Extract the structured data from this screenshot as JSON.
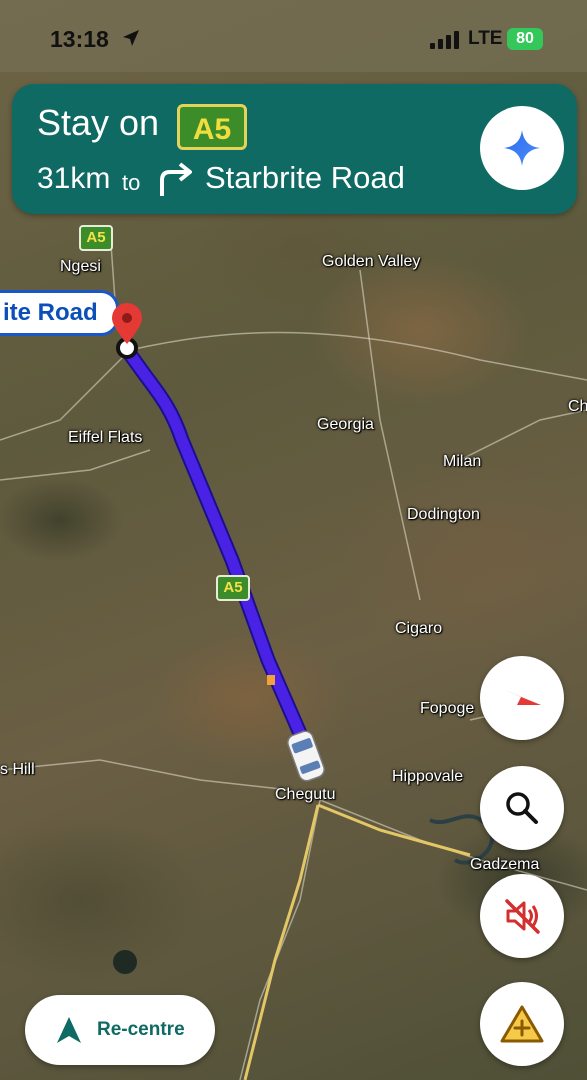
{
  "status_bar": {
    "time": "13:18",
    "network": "LTE",
    "battery": "80"
  },
  "banner": {
    "instruction": "Stay on",
    "road": "A5",
    "distance": "31km",
    "to": "to",
    "street": "Starbrite Road",
    "bg_color": "#0e6a63"
  },
  "map": {
    "destination_label": "ite Road",
    "labels": {
      "ngesi": "Ngesi",
      "golden_valley": "Golden Valley",
      "eiffel_flats": "Eiffel Flats",
      "georgia": "Georgia",
      "milan": "Milan",
      "dodington": "Dodington",
      "cigaro": "Cigaro",
      "fopoge": "Fopoge",
      "chegutu": "Chegutu",
      "hippovale": "Hippovale",
      "gadzema": "Gadzema",
      "s_hill": "s Hill",
      "ch": "Ch"
    },
    "shields": {
      "top": "A5",
      "route": "A5"
    },
    "route_color": "#4a22e6"
  },
  "controls": {
    "recentre_label": "Re-centre",
    "compass_icon": "compass-icon",
    "search_icon": "search-icon",
    "mute_icon": "sound-muted-icon",
    "report_icon": "report-incident-icon"
  }
}
